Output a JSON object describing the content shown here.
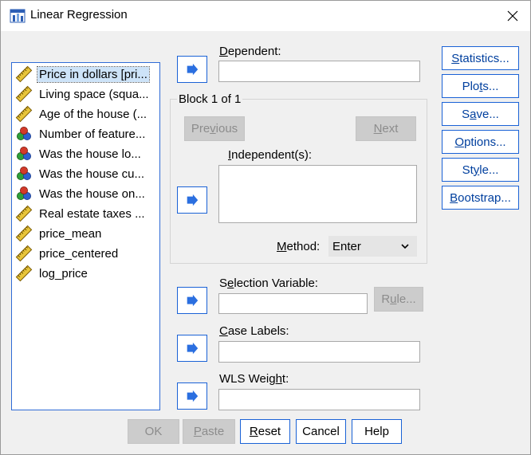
{
  "window": {
    "title": "Linear Regression"
  },
  "variables": [
    {
      "label": "Price in dollars [pri...",
      "icon": "scale-ruler-icon",
      "selected": true
    },
    {
      "label": "Living space (squa...",
      "icon": "scale-ruler-icon"
    },
    {
      "label": "Age of the house (...",
      "icon": "scale-ruler-icon"
    },
    {
      "label": "Number of feature...",
      "icon": "nominal-balls-icon"
    },
    {
      "label": "Was the house lo...",
      "icon": "nominal-balls-icon"
    },
    {
      "label": "Was the house cu...",
      "icon": "nominal-balls-icon"
    },
    {
      "label": "Was the house on...",
      "icon": "nominal-balls-icon"
    },
    {
      "label": "Real estate taxes ...",
      "icon": "scale-ruler-icon"
    },
    {
      "label": "price_mean",
      "icon": "scale-ruler-icon"
    },
    {
      "label": "price_centered",
      "icon": "scale-ruler-icon"
    },
    {
      "label": "log_price",
      "icon": "scale-ruler-icon"
    }
  ],
  "dependent": {
    "label_u": "D",
    "label_rest": "ependent:",
    "value": ""
  },
  "block": {
    "title": "Block 1 of 1",
    "previous_pre": "Pre",
    "previous_u": "v",
    "previous_post": "ious",
    "next_u": "N",
    "next_rest": "ext",
    "independent_pre": "",
    "independent_u": "I",
    "independent_rest": "ndependent(s):",
    "method_u": "M",
    "method_rest": "ethod:",
    "method_value": "Enter"
  },
  "selection": {
    "label_pre": "S",
    "label_u": "e",
    "label_rest": "lection Variable:",
    "rule_pre": "R",
    "rule_u": "u",
    "rule_post": "le..."
  },
  "case_labels": {
    "label_u": "C",
    "label_rest": "ase Labels:"
  },
  "wls": {
    "label_pre": "WLS Weig",
    "label_u": "h",
    "label_rest": "t:"
  },
  "side_buttons": {
    "statistics_u": "S",
    "statistics_rest": "tatistics...",
    "plots_pre": "Plo",
    "plots_u": "t",
    "plots_rest": "s...",
    "save_pre": "S",
    "save_u": "a",
    "save_rest": "ve...",
    "options_u": "O",
    "options_rest": "ptions...",
    "style_pre": "St",
    "style_u": "y",
    "style_rest": "le...",
    "bootstrap_u": "B",
    "bootstrap_rest": "ootstrap..."
  },
  "bottom_buttons": {
    "ok": "OK",
    "paste_u": "P",
    "paste_rest": "aste",
    "reset_u": "R",
    "reset_rest": "eset",
    "cancel": "Cancel",
    "help": "Help"
  },
  "colors": {
    "accent": "#1a62d6",
    "selection": "#cde3f8",
    "disabled": "#cccccc",
    "arrow": "#2b6fe0"
  }
}
